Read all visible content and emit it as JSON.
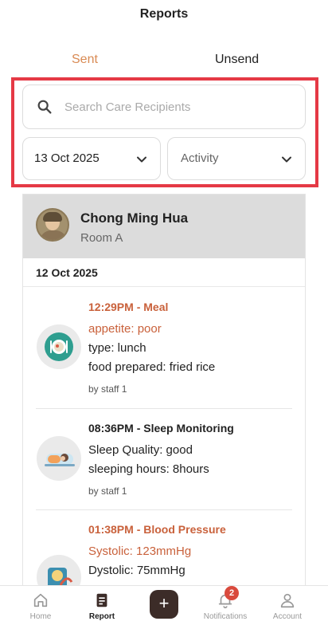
{
  "header": {
    "title": "Reports"
  },
  "tabs": [
    {
      "label": "Sent",
      "active": true
    },
    {
      "label": "Unsend",
      "active": false
    }
  ],
  "search": {
    "placeholder": "Search Care Recipients",
    "value": ""
  },
  "filters": {
    "date": {
      "value": "13 Oct 2025"
    },
    "activity": {
      "value": "Activity"
    }
  },
  "recipient": {
    "name": "Chong Ming Hua",
    "room": "Room A"
  },
  "date_group": "12 Oct 2025",
  "entries": [
    {
      "title": "12:29PM - Meal",
      "icon": "meal-icon",
      "lines": [
        "appetite: poor",
        "type: lunch",
        "food prepared: fried rice"
      ],
      "staff": "by staff 1"
    },
    {
      "title": "08:36PM - Sleep Monitoring",
      "icon": "sleep-icon",
      "lines": [
        "Sleep Quality: good",
        "sleeping hours: 8hours"
      ],
      "staff": "by staff 1"
    },
    {
      "title": "01:38PM - Blood Pressure",
      "icon": "blood-pressure-icon",
      "lines": [
        "Systolic: 123mmHg",
        "Dystolic: 75mmHg"
      ],
      "staff": ""
    }
  ],
  "nav": {
    "home": "Home",
    "report": "Report",
    "notifications": "Notifications",
    "account": "Account",
    "notification_count": "2"
  },
  "colors": {
    "accent_orange": "#d98a53",
    "alert_orange": "#c9613b",
    "highlight_red": "#e53945",
    "fab_brown": "#3c2c28",
    "badge_red": "#d94a3d"
  }
}
